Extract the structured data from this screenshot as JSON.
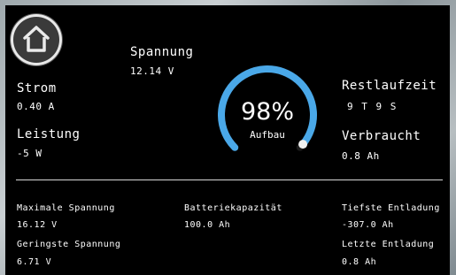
{
  "home": {
    "icon": "home-icon"
  },
  "spannung": {
    "label": "Spannung",
    "value": "12.14 V"
  },
  "strom": {
    "label": "Strom",
    "value": "0.40 A"
  },
  "leistung": {
    "label": "Leistung",
    "value": "-5 W"
  },
  "gauge": {
    "percent_text": "98%",
    "percent": 0.98,
    "status": "Aufbau",
    "accent": "#4aa8e8"
  },
  "restlaufzeit": {
    "label": "Restlaufzeit",
    "value": "9 T  9 S"
  },
  "verbraucht": {
    "label": "Verbraucht",
    "value": "0.8 Ah"
  },
  "stats": {
    "max_spannung": {
      "label": "Maximale Spannung",
      "value": "16.12 V"
    },
    "batteriekapazitaet": {
      "label": "Batteriekapazität",
      "value": "100.0 Ah"
    },
    "tiefste_entladung": {
      "label": "Tiefste Entladung",
      "value": "-307.0 Ah"
    },
    "geringste_spannung": {
      "label": "Geringste Spannung",
      "value": "6.71 V"
    },
    "letzte_entladung": {
      "label": "Letzte Entladung",
      "value": "0.8 Ah"
    }
  }
}
